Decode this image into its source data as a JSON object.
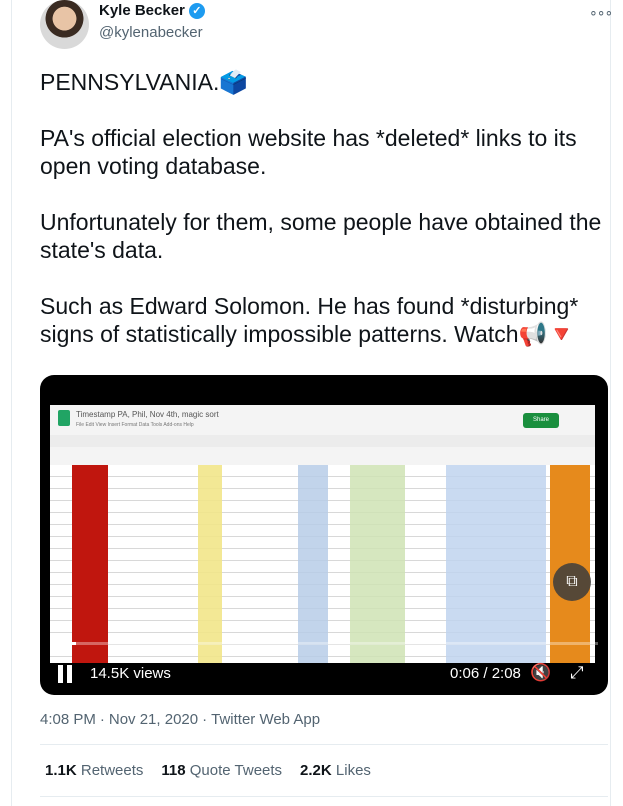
{
  "author": {
    "name": "Kyle Becker",
    "handle": "@kylenabecker",
    "verified_icon": "✓",
    "more_icon": "∘∘∘"
  },
  "tweet": {
    "text": "PENNSYLVANIA.🗳️\n\nPA's official election website has *deleted* links to its open voting database.\n\nUnfortunately for them, some people have obtained the state's data.\n\nSuch as Edward Solomon. He has found *disturbing* signs of statistically impossible patterns. Watch📢🔻"
  },
  "video": {
    "sheet_title": "Timestamp PA, Phil, Nov 4th, magic sort",
    "sheet_menu": "File   Edit   View   Insert   Format   Data   Tools   Add-ons   Help",
    "share_label": "Share",
    "views": "14.5K views",
    "time": "0:06 / 2:08",
    "progress": 0.048,
    "pip_icon": "⧉",
    "mute_icon": "🔇",
    "fullscreen_icon": "⤢"
  },
  "meta": {
    "time": "4:08 PM",
    "sep1": "·",
    "date": "Nov 21, 2020",
    "sep2": "·",
    "source": "Twitter Web App"
  },
  "stats": {
    "retweets_count": "1.1K",
    "retweets_label": "Retweets",
    "quotes_count": "118",
    "quotes_label": "Quote Tweets",
    "likes_count": "2.2K",
    "likes_label": "Likes"
  }
}
